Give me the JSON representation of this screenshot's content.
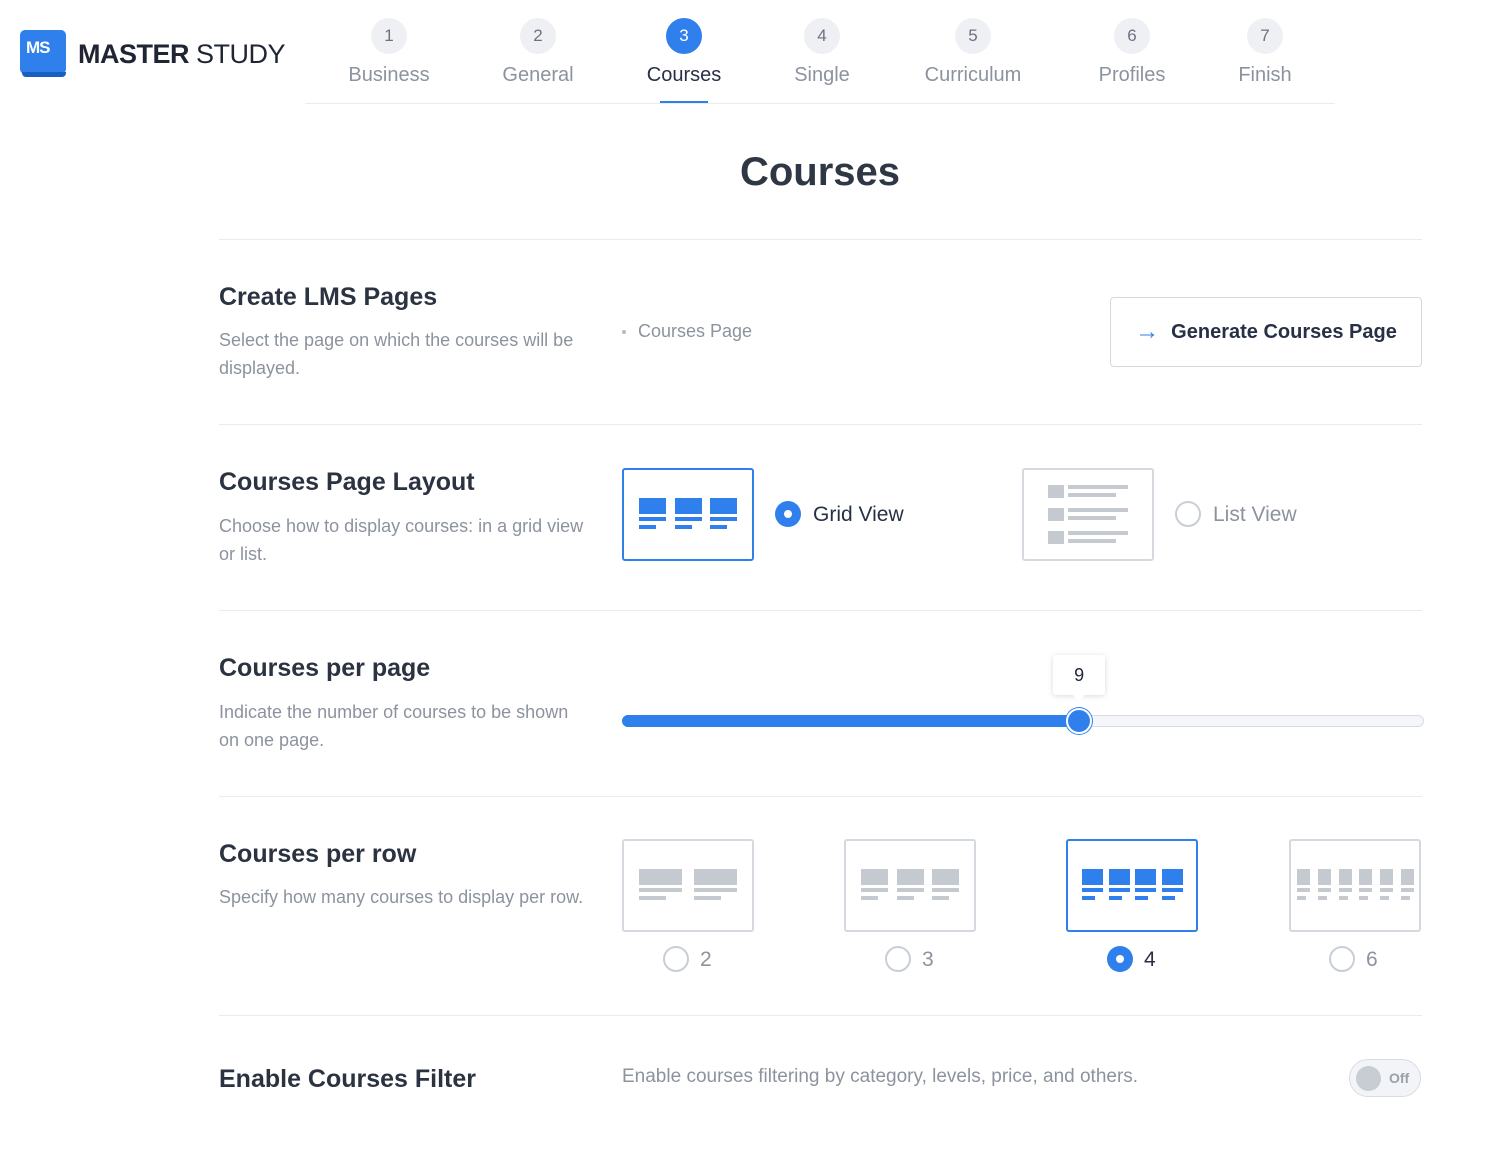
{
  "brand": {
    "logo_mark": "MS",
    "name_bold": "MASTER",
    "name_light": "STUDY",
    "accent_color": "#2f80ed"
  },
  "steps": [
    {
      "num": "1",
      "label": "Business",
      "active": false
    },
    {
      "num": "2",
      "label": "General",
      "active": false
    },
    {
      "num": "3",
      "label": "Courses",
      "active": true
    },
    {
      "num": "4",
      "label": "Single",
      "active": false
    },
    {
      "num": "5",
      "label": "Curriculum",
      "active": false
    },
    {
      "num": "6",
      "label": "Profiles",
      "active": false
    },
    {
      "num": "7",
      "label": "Finish",
      "active": false
    }
  ],
  "page_title": "Courses",
  "sections": {
    "lms_pages": {
      "title": "Create LMS Pages",
      "desc": "Select the page on which the courses will be displayed.",
      "page_item": "Courses Page",
      "button_label": "Generate Courses Page",
      "button_icon": "arrow-right-icon"
    },
    "layout": {
      "title": "Courses Page Layout",
      "desc": "Choose how to display courses: in a grid view or list.",
      "options": [
        {
          "label": "Grid View",
          "selected": true
        },
        {
          "label": "List View",
          "selected": false
        }
      ]
    },
    "per_page": {
      "title": "Courses per page",
      "desc": "Indicate the number of courses to be shown on one page.",
      "value": "9",
      "fraction": 0.57
    },
    "per_row": {
      "title": "Courses per row",
      "desc": "Specify how many courses to display per row.",
      "options": [
        {
          "label": "2",
          "selected": false
        },
        {
          "label": "3",
          "selected": false
        },
        {
          "label": "4",
          "selected": true
        },
        {
          "label": "6",
          "selected": false
        }
      ]
    },
    "filter": {
      "title": "Enable Courses Filter",
      "desc": "Enable courses filtering by category, levels, price, and others.",
      "toggle_label": "Off",
      "enabled": false
    }
  }
}
